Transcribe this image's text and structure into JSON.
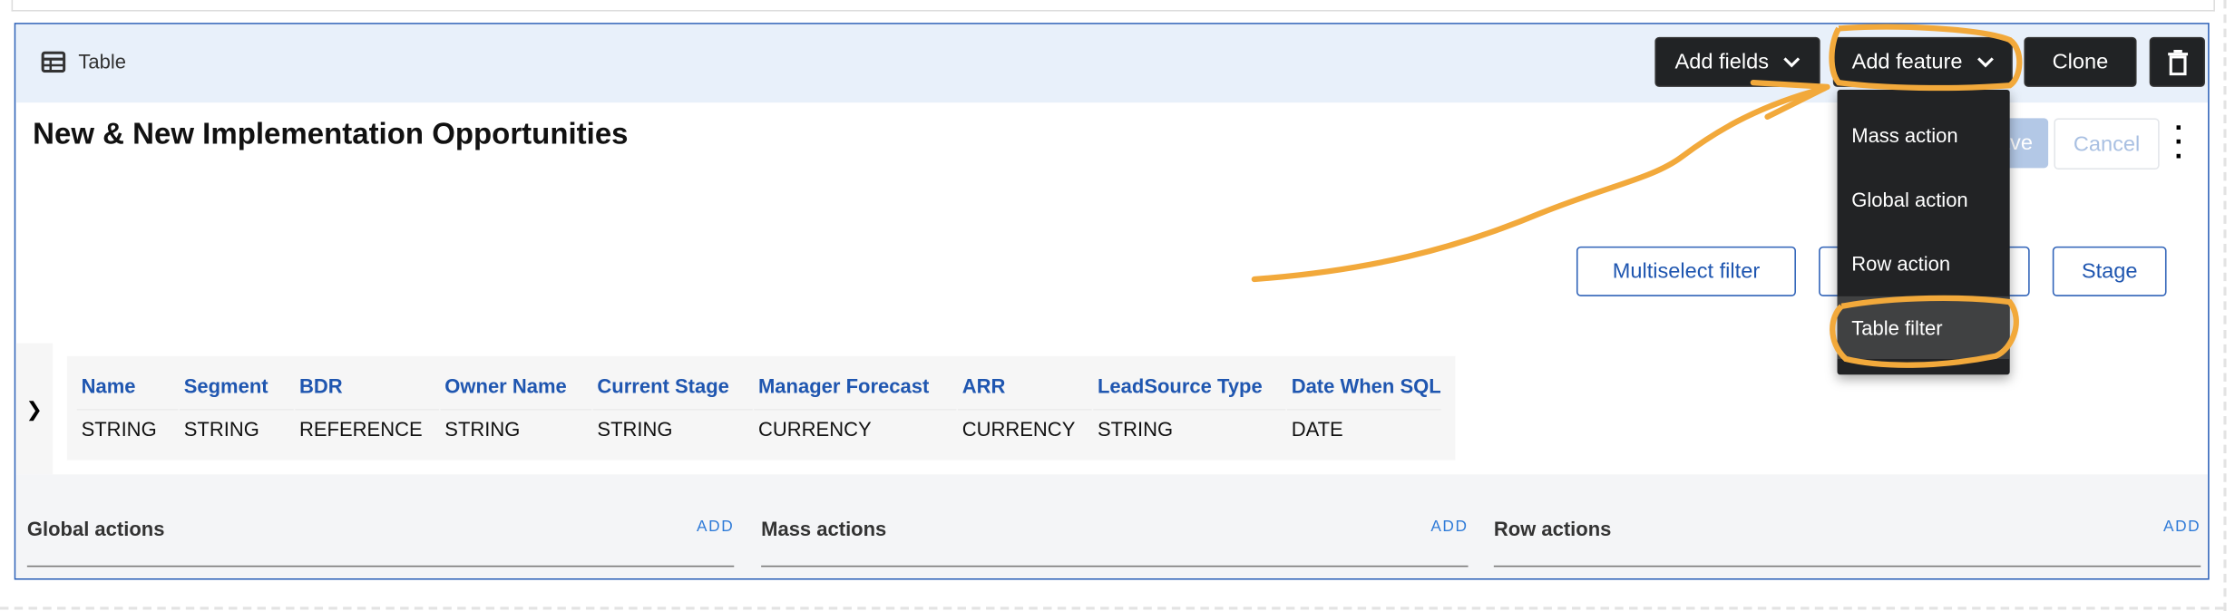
{
  "header": {
    "icon": "table-icon",
    "title": "Table"
  },
  "toolbar": {
    "add_fields": "Add fields",
    "add_feature": "Add feature",
    "clone": "Clone",
    "delete_icon": "trash-icon"
  },
  "page": {
    "title": "New & New Implementation Opportunities",
    "save": "Save",
    "cancel": "Cancel"
  },
  "dropdown": {
    "items": [
      {
        "label": "Mass action"
      },
      {
        "label": "Global action"
      },
      {
        "label": "Row action"
      },
      {
        "label": "Table filter",
        "highlighted": true
      }
    ]
  },
  "filters": [
    {
      "label": "Multiselect filter"
    },
    {
      "label": "Stage"
    }
  ],
  "table": {
    "columns": [
      {
        "name": "Name",
        "type": "STRING"
      },
      {
        "name": "Segment",
        "type": "STRING"
      },
      {
        "name": "BDR",
        "type": "REFERENCE"
      },
      {
        "name": "Owner Name",
        "type": "STRING"
      },
      {
        "name": "Current Stage",
        "type": "STRING"
      },
      {
        "name": "Manager Forecast",
        "type": "CURRENCY"
      },
      {
        "name": "ARR",
        "type": "CURRENCY"
      },
      {
        "name": "LeadSource Type",
        "type": "STRING"
      },
      {
        "name": "Date When SQL",
        "type": "DATE"
      }
    ]
  },
  "sections": [
    {
      "label": "Global actions",
      "add": "ADD"
    },
    {
      "label": "Mass actions",
      "add": "ADD"
    },
    {
      "label": "Row actions",
      "add": "ADD"
    }
  ],
  "colors": {
    "accent": "#1f56b0",
    "header_bg": "#e8f0fa",
    "dark_button": "#212325",
    "annotation": "#f2a93b"
  }
}
